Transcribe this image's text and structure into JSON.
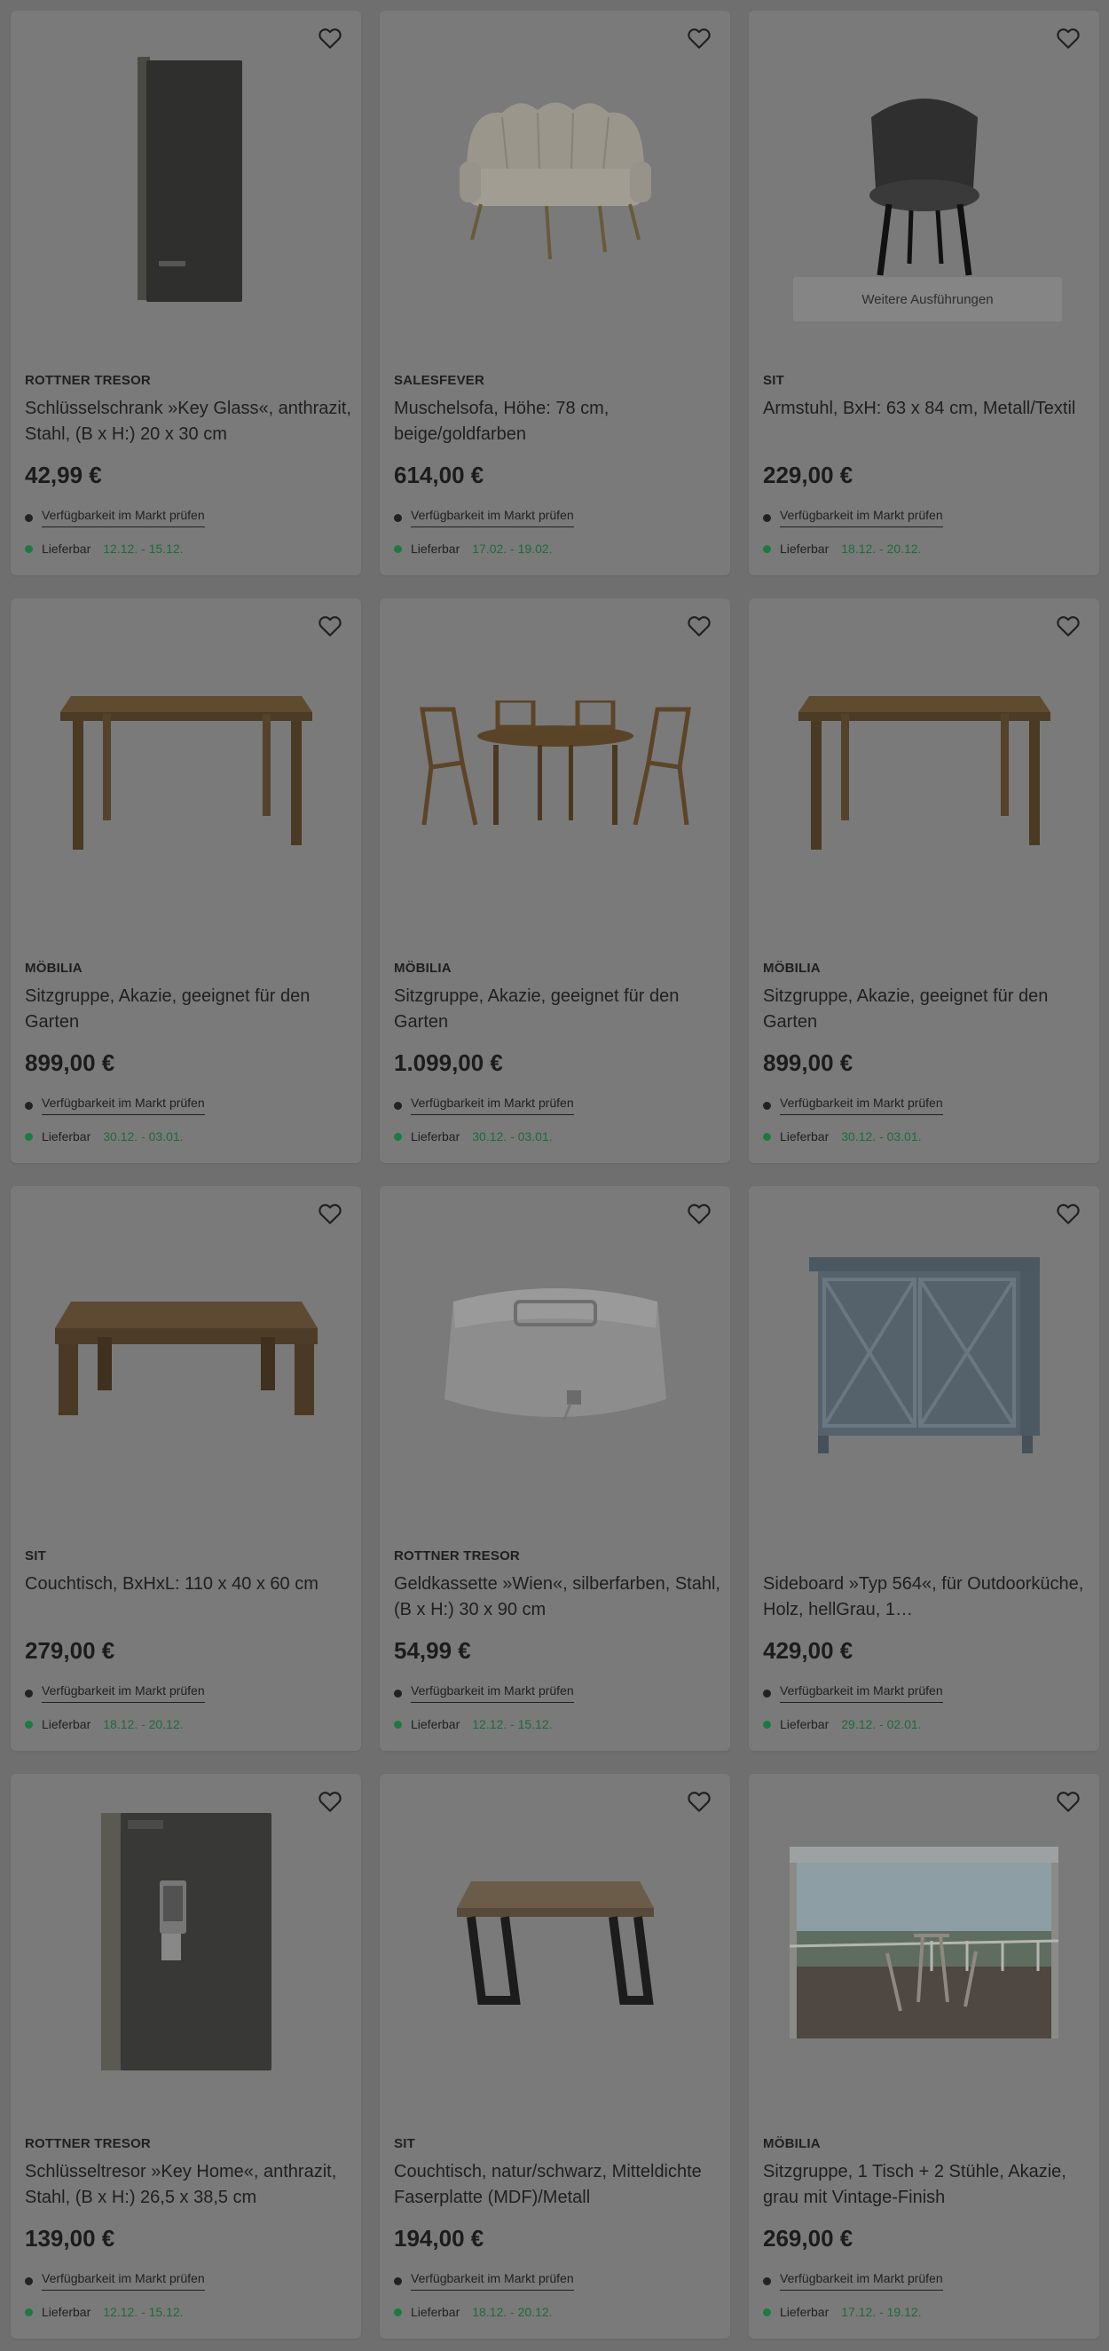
{
  "common": {
    "availability_label": "Verfügbarkeit im Markt prüfen",
    "delivery_label": "Lieferbar",
    "favorite_icon": "heart-outline-icon"
  },
  "products": [
    {
      "brand": "ROTTNER TRESOR",
      "title": "Schlüsselschrank »Key Glass«, anthrazit, Stahl, (B x H:) 20 x 30 cm",
      "price": "42,99 €",
      "delivery": "12.12. - 15.12.",
      "image": "key-cabinet-glass"
    },
    {
      "brand": "SALESFEVER",
      "title": "Muschelsofa, Höhe: 78 cm, beige/goldfarben",
      "price": "614,00 €",
      "delivery": "17.02. - 19.02.",
      "image": "shell-sofa"
    },
    {
      "brand": "SIT",
      "title": "Armstuhl, BxH: 63 x 84 cm, Metall/Textil",
      "price": "229,00 €",
      "delivery": "18.12. - 20.12.",
      "image": "armchair",
      "variants_label": "Weitere Ausführungen"
    },
    {
      "brand": "MÖBILIA",
      "title": "Sitzgruppe, Akazie, geeignet für den Garten",
      "price": "899,00 €",
      "delivery": "30.12. - 03.01.",
      "image": "garden-table"
    },
    {
      "brand": "MÖBILIA",
      "title": "Sitzgruppe, Akazie, geeignet für den Garten",
      "price": "1.099,00 €",
      "delivery": "30.12. - 03.01.",
      "image": "garden-set"
    },
    {
      "brand": "MÖBILIA",
      "title": "Sitzgruppe, Akazie, geeignet für den Garten",
      "price": "899,00 €",
      "delivery": "30.12. - 03.01.",
      "image": "garden-table"
    },
    {
      "brand": "SIT",
      "title": "Couchtisch, BxHxL: 110 x 40 x 60 cm",
      "price": "279,00 €",
      "delivery": "18.12. - 20.12.",
      "image": "coffee-table"
    },
    {
      "brand": "ROTTNER TRESOR",
      "title": "Geldkassette »Wien«, silberfarben, Stahl, (B x H:) 30 x 90 cm",
      "price": "54,99 €",
      "delivery": "12.12. - 15.12.",
      "image": "cash-box"
    },
    {
      "brand": "",
      "title": "Sideboard »Typ 564«, für Outdoorküche, Holz, hellGrau, 1…",
      "price": "429,00 €",
      "delivery": "29.12. - 02.01.",
      "image": "sideboard"
    },
    {
      "brand": "ROTTNER TRESOR",
      "title": "Schlüsseltresor »Key Home«, anthrazit, Stahl, (B x H:) 26,5 x 38,5 cm",
      "price": "139,00 €",
      "delivery": "12.12. - 15.12.",
      "image": "key-safe"
    },
    {
      "brand": "SIT",
      "title": "Couchtisch, natur/schwarz, Mitteldichte Faserplatte (MDF)/Metall",
      "price": "194,00 €",
      "delivery": "18.12. - 20.12.",
      "image": "coffee-table-metal"
    },
    {
      "brand": "MÖBILIA",
      "title": "Sitzgruppe, 1 Tisch + 2 Stühle, Akazie, grau mit Vintage-Finish",
      "price": "269,00 €",
      "delivery": "17.12. - 19.12.",
      "image": "bistro-photo"
    }
  ]
}
